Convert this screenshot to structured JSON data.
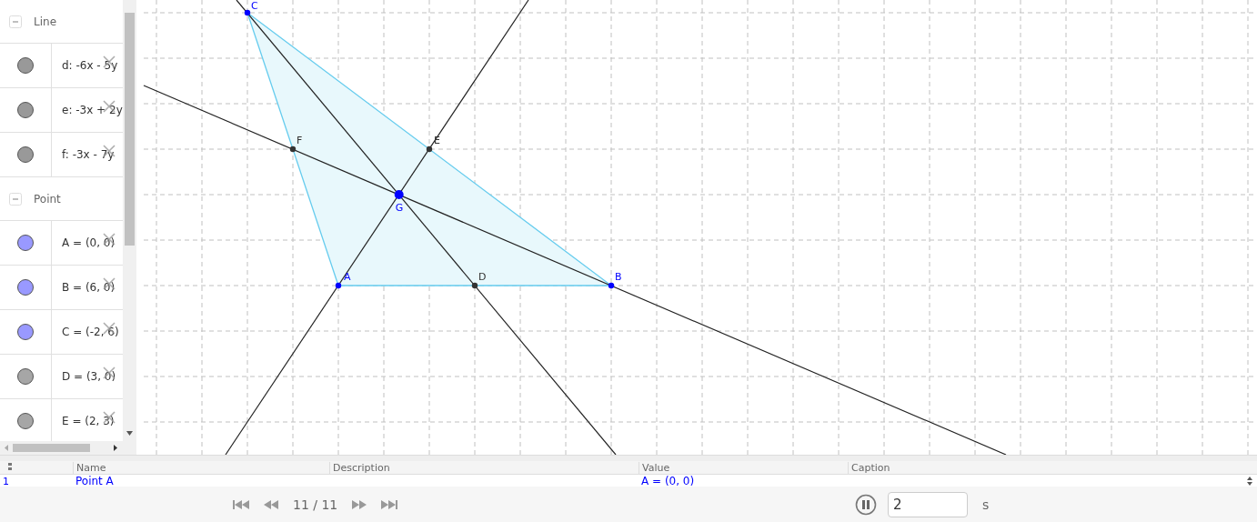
{
  "algebra": {
    "groups": [
      {
        "label": "Line",
        "expanded": true,
        "items": [
          {
            "text": "d: -6x - 5y",
            "color": "#999999"
          },
          {
            "text": "e: -3x + 2y",
            "color": "#999999"
          },
          {
            "text": "f: -3x - 7y",
            "color": "#999999"
          }
        ]
      },
      {
        "label": "Point",
        "expanded": true,
        "items": [
          {
            "text": "A = (0, 0)",
            "color": "#9999ff"
          },
          {
            "text": "B = (6, 0)",
            "color": "#9999ff"
          },
          {
            "text": "C = (-2, 6)",
            "color": "#9999ff"
          },
          {
            "text": "D = (3, 0)",
            "color": "#a6a6a6"
          },
          {
            "text": "E = (2, 3)",
            "color": "#a6a6a6"
          }
        ]
      }
    ]
  },
  "graph": {
    "points": [
      {
        "label": "C",
        "color": "#0000ff"
      },
      {
        "label": "F",
        "color": "#333333"
      },
      {
        "label": "E",
        "color": "#333333"
      },
      {
        "label": "G",
        "color": "#0000ff"
      },
      {
        "label": "A",
        "color": "#0000ff"
      },
      {
        "label": "D",
        "color": "#333333"
      },
      {
        "label": "B",
        "color": "#0000ff"
      }
    ]
  },
  "table": {
    "columns": [
      "Name",
      "Description",
      "Value",
      "Caption"
    ],
    "rows": [
      {
        "number": "1",
        "cells": [
          "Point A",
          "",
          "A = (0, 0)",
          ""
        ]
      }
    ]
  },
  "playback": {
    "position": "11 / 11",
    "playing": true,
    "speed": "2",
    "unit": "s"
  }
}
